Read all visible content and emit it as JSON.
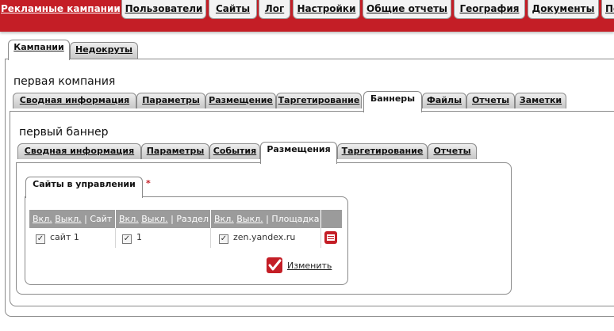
{
  "topnav": {
    "tabs": [
      {
        "label": "Рекламные кампании",
        "active": true
      },
      {
        "label": "Пользователи"
      },
      {
        "label": "Сайты"
      },
      {
        "label": "Лог"
      },
      {
        "label": "Настройки"
      },
      {
        "label": "Общие отчеты"
      },
      {
        "label": "География"
      },
      {
        "label": "Документы"
      },
      {
        "label": "Пс"
      }
    ]
  },
  "level1": {
    "tabs": [
      {
        "label": "Кампании",
        "active": true
      },
      {
        "label": "Недокруты"
      }
    ],
    "title": "первая компания"
  },
  "level2": {
    "tabs": [
      {
        "label": "Сводная информация"
      },
      {
        "label": "Параметры"
      },
      {
        "label": "Размещение"
      },
      {
        "label": "Таргетирование"
      },
      {
        "label": "Баннеры",
        "active": true
      },
      {
        "label": "Файлы"
      },
      {
        "label": "Отчеты"
      },
      {
        "label": "Заметки"
      }
    ],
    "title": "первый баннер"
  },
  "level3": {
    "tabs": [
      {
        "label": "Сводная информация"
      },
      {
        "label": "Параметры"
      },
      {
        "label": "События"
      },
      {
        "label": "Размещения",
        "active": true
      },
      {
        "label": "Таргетирование"
      },
      {
        "label": "Отчеты"
      }
    ]
  },
  "level4": {
    "tabs": [
      {
        "label": "Сайты в управлении",
        "active": true
      }
    ],
    "required_marker": "*"
  },
  "table": {
    "headers": [
      {
        "on": "Вкл.",
        "off": "Выкл.",
        "name": "Сайт"
      },
      {
        "on": "Вкл.",
        "off": "Выкл.",
        "name": "Раздел"
      },
      {
        "on": "Вкл.",
        "off": "Выкл.",
        "name": "Площадка"
      }
    ],
    "row": {
      "site": "сайт 1",
      "section": "1",
      "placement": "zen.yandex.ru",
      "site_checked": true,
      "section_checked": true,
      "placement_checked": true
    },
    "separator": "|"
  },
  "actions": {
    "change_label": "Изменить"
  },
  "colors": {
    "accent": "#c41e26",
    "header_gray": "#9b9b9b"
  }
}
